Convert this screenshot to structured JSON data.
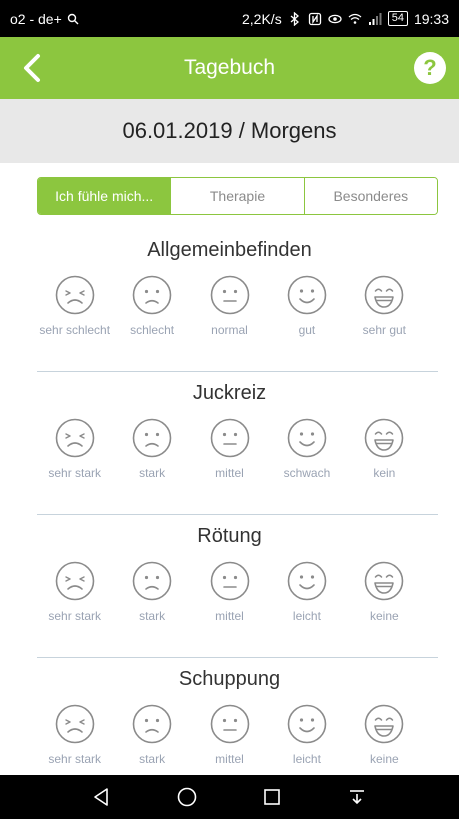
{
  "status_bar": {
    "carrier": "o2 - de+",
    "speed": "2,2K/s",
    "battery": "54",
    "time": "19:33"
  },
  "app_bar": {
    "title": "Tagebuch",
    "help_label": "?"
  },
  "date_header": "06.01.2019 / Morgens",
  "tabs": [
    {
      "label": "Ich fühle mich...",
      "active": true
    },
    {
      "label": "Therapie",
      "active": false
    },
    {
      "label": "Besonderes",
      "active": false
    }
  ],
  "sections": [
    {
      "title": "Allgemeinbefinden",
      "labels": [
        "sehr schlecht",
        "schlecht",
        "normal",
        "gut",
        "sehr gut"
      ]
    },
    {
      "title": "Juckreiz",
      "labels": [
        "sehr stark",
        "stark",
        "mittel",
        "schwach",
        "kein"
      ]
    },
    {
      "title": "Rötung",
      "labels": [
        "sehr stark",
        "stark",
        "mittel",
        "leicht",
        "keine"
      ]
    },
    {
      "title": "Schuppung",
      "labels": [
        "sehr stark",
        "stark",
        "mittel",
        "leicht",
        "keine"
      ]
    }
  ],
  "icons": {
    "faces": [
      "very-sad-face-icon",
      "sad-face-icon",
      "neutral-face-icon",
      "smile-face-icon",
      "grin-face-icon"
    ],
    "nav": [
      "back-triangle-icon",
      "home-circle-icon",
      "recents-square-icon",
      "notification-down-icon"
    ]
  },
  "colors": {
    "accent": "#8cc63f",
    "face_stroke": "#8b8b8b",
    "label": "#9aa3b3",
    "divider": "#c7d3dc",
    "date_bg": "#e8e8e8"
  }
}
